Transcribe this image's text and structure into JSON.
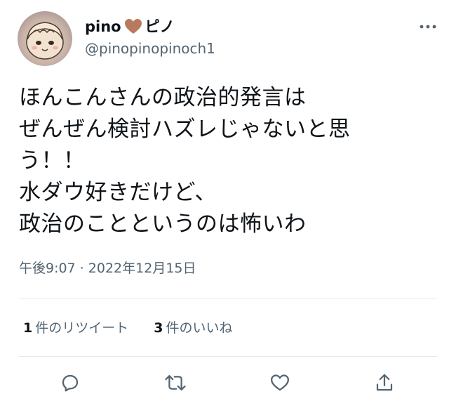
{
  "user": {
    "display_name": "pino",
    "display_name_suffix": "ピノ",
    "handle": "@pinopinopinoch1"
  },
  "tweet": {
    "lines": [
      "ほんこんさんの政治的発言は",
      "ぜんぜん検討ハズレじゃないと思",
      "う！！",
      "水ダウ好きだけど、",
      "政治のことというのは怖いわ"
    ],
    "timestamp": "午後9:07 · 2022年12月15日"
  },
  "stats": {
    "retweets_count": "1",
    "retweets_label": "件のリツイート",
    "likes_count": "3",
    "likes_label": "件のいいね"
  },
  "icons": {
    "heart_emoji_color": "#b87a5e",
    "more": "more-icon",
    "reply": "reply-icon",
    "retweet": "retweet-icon",
    "like": "like-icon",
    "share": "share-icon"
  }
}
